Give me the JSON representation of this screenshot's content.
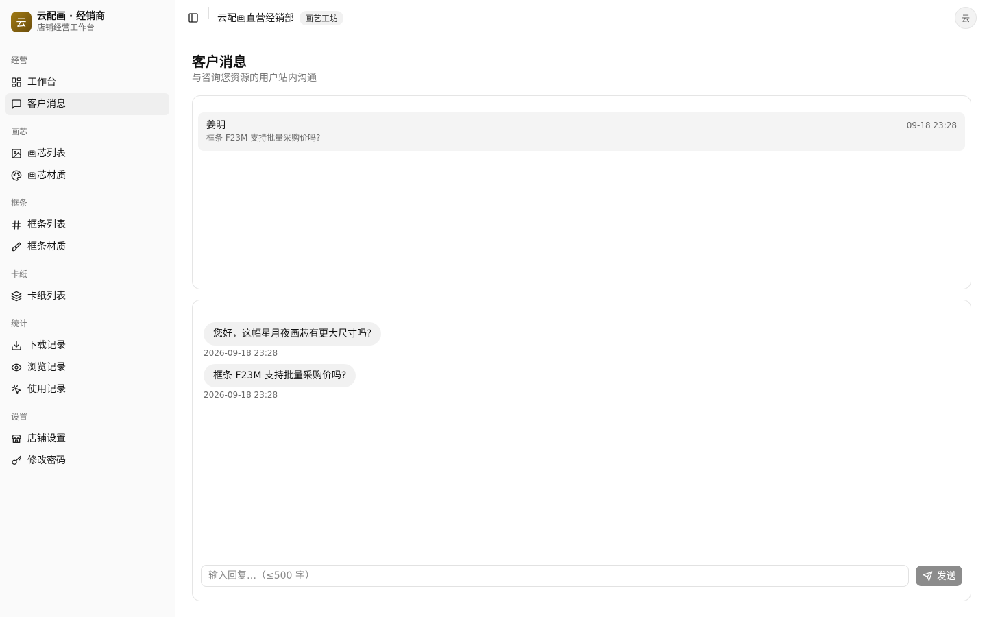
{
  "brand": {
    "logo_char": "云",
    "name": "云配画 · 经销商",
    "subtitle": "店铺经营工作台"
  },
  "sidebar": {
    "groups": [
      {
        "label": "经营",
        "items": [
          {
            "label": "工作台",
            "icon": "dashboard-icon"
          },
          {
            "label": "客户消息",
            "icon": "message-icon",
            "active": true
          }
        ]
      },
      {
        "label": "画芯",
        "items": [
          {
            "label": "画芯列表",
            "icon": "image-icon"
          },
          {
            "label": "画芯材质",
            "icon": "palette-icon"
          }
        ]
      },
      {
        "label": "框条",
        "items": [
          {
            "label": "框条列表",
            "icon": "hash-icon"
          },
          {
            "label": "框条材质",
            "icon": "brush-icon"
          }
        ]
      },
      {
        "label": "卡纸",
        "items": [
          {
            "label": "卡纸列表",
            "icon": "layers-icon"
          }
        ]
      },
      {
        "label": "统计",
        "items": [
          {
            "label": "下载记录",
            "icon": "download-icon"
          },
          {
            "label": "浏览记录",
            "icon": "eye-icon"
          },
          {
            "label": "使用记录",
            "icon": "pointer-icon"
          }
        ]
      },
      {
        "label": "设置",
        "items": [
          {
            "label": "店铺设置",
            "icon": "store-icon"
          },
          {
            "label": "修改密码",
            "icon": "key-icon"
          }
        ]
      }
    ]
  },
  "topbar": {
    "shop_name": "云配画直营经销部",
    "shop_tag": "画艺工坊",
    "avatar": "云"
  },
  "page": {
    "title": "客户消息",
    "subtitle": "与咨询您资源的用户站内沟通"
  },
  "conversations": [
    {
      "name": "姜明",
      "preview": "框条 F23M 支持批量采购价吗?",
      "time": "09-18 23:28"
    }
  ],
  "messages": [
    {
      "text": "您好，这幅星月夜画芯有更大尺寸吗?",
      "time": "2026-09-18 23:28"
    },
    {
      "text": "框条 F23M 支持批量采购价吗?",
      "time": "2026-09-18 23:28"
    }
  ],
  "reply": {
    "placeholder": "输入回复…（≤500 字）",
    "value": "",
    "send_label": "发送"
  }
}
